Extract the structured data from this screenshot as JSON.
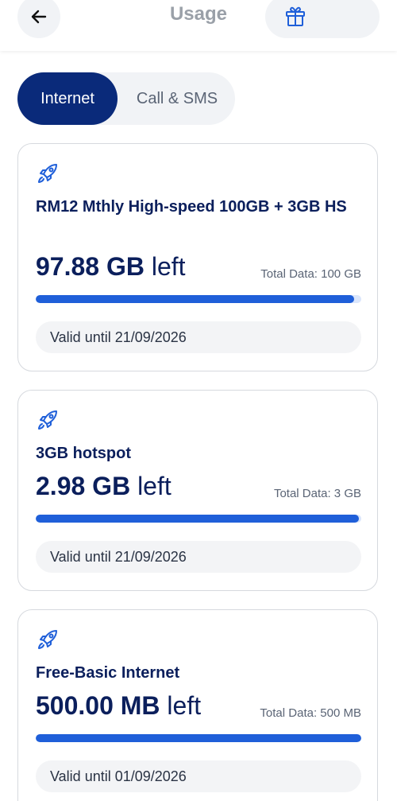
{
  "header": {
    "title": "Usage",
    "back_icon": "arrow-left-icon",
    "gift_icon": "gift-icon"
  },
  "tabs": [
    {
      "label": "Internet",
      "active": true
    },
    {
      "label": "Call & SMS",
      "active": false
    }
  ],
  "plans": [
    {
      "name": "RM12 Mthly High-speed 100GB + 3GB HS",
      "amount": "97.88 GB",
      "left_word": "left",
      "total": "Total Data: 100 GB",
      "remaining_fraction": 0.9788,
      "valid": "Valid until 21/09/2026",
      "icon": "rocket-icon"
    },
    {
      "name": "3GB hotspot",
      "amount": "2.98 GB",
      "left_word": "left",
      "total": "Total Data: 3 GB",
      "remaining_fraction": 0.9933,
      "valid": "Valid until 21/09/2026",
      "icon": "rocket-icon"
    },
    {
      "name": "Free-Basic Internet",
      "amount": "500.00 MB",
      "left_word": "left",
      "total": "Total Data: 500 MB",
      "remaining_fraction": 1.0,
      "valid": "Valid until 01/09/2026",
      "icon": "rocket-icon"
    }
  ],
  "colors": {
    "primary": "#0a2a7a",
    "bar": "#1f5fd9",
    "bar_track": "#dbe6fb"
  }
}
